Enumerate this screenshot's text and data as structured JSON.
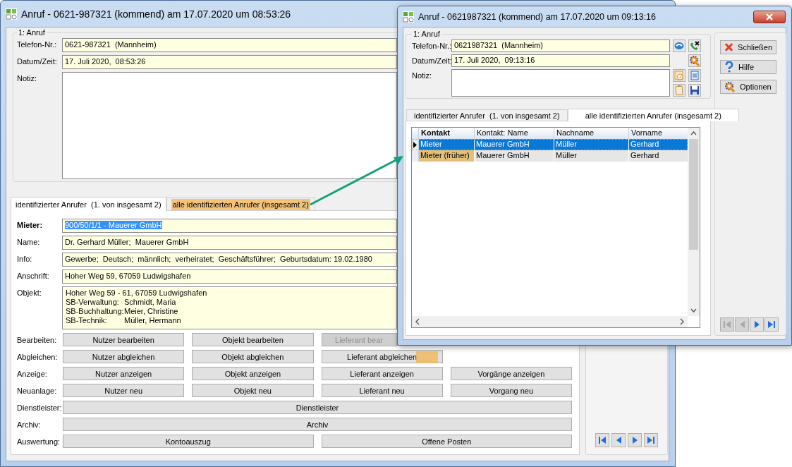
{
  "main_window": {
    "title": "Anruf - 0621-987321 (kommend) am 17.07.2020 um 08:53:26",
    "call_group": {
      "title": "1: Anruf",
      "fields": [
        {
          "label": "Telefon-Nr.:",
          "value": "0621-987321  (Mannheim)",
          "kind": "line"
        },
        {
          "label": "Datum/Zeit:",
          "value": "17. Juli 2020,  08:53:26",
          "kind": "line"
        },
        {
          "label": "Notiz:",
          "kind": "memo"
        }
      ]
    },
    "tabs": [
      {
        "label": "identifizierter Anrufer  (1. von insgesamt 2)",
        "selected": true,
        "highlighted": false
      },
      {
        "label": "alle identifizierten Anrufer (insgesamt 2)",
        "selected": false,
        "highlighted": true
      }
    ],
    "caller_fields": [
      {
        "label": "Mieter:",
        "value": "900/50/1/1 - Mauerer GmbH",
        "emphasized": true,
        "value_selected": true
      },
      {
        "label": "Name:",
        "value": "Dr. Gerhard Müller;  Mauerer GmbH",
        "emphasized": false,
        "value_selected": false
      },
      {
        "label": "Info:",
        "value": "Gewerbe;  Deutsch;  männlich;  verheiratet;  Geschäftsführer;  Geburtsdatum: 19.02.1980",
        "emphasized": false,
        "value_selected": false
      },
      {
        "label": "Anschrift:",
        "value": "Hoher Weg 59, 67059 Ludwigshafen",
        "emphasized": false,
        "value_selected": false
      }
    ],
    "object_field": {
      "label": "Objekt:",
      "address": "Hoher Weg 59 - 61, 67059 Ludwigshafen",
      "contacts": [
        {
          "role": "SB-Verwaltung:",
          "name": "Schmidt, Maria"
        },
        {
          "role": "SB-Buchhaltung:",
          "name": "Meier, Christine"
        },
        {
          "role": "SB-Technik:",
          "name": "Müller, Hermann"
        }
      ]
    },
    "action_rows": [
      {
        "label": "Bearbeiten:",
        "kind": "quarters",
        "buttons": [
          {
            "label": "Nutzer bearbeiten",
            "disabled": false,
            "highlighted": false
          },
          {
            "label": "Objekt bearbeiten",
            "disabled": false,
            "highlighted": false
          },
          {
            "label": "Lieferant bear",
            "disabled": true,
            "highlighted": false,
            "clipped": true
          }
        ]
      },
      {
        "label": "Abgleichen:",
        "kind": "quarters",
        "buttons": [
          {
            "label": "Nutzer abgleichen",
            "disabled": false,
            "highlighted": false
          },
          {
            "label": "Objekt abgleichen",
            "disabled": false,
            "highlighted": false
          },
          {
            "label": "Lieferant abgleichen",
            "disabled": false,
            "highlighted": true
          }
        ]
      },
      {
        "label": "Anzeige:",
        "kind": "quarters",
        "buttons": [
          {
            "label": "Nutzer anzeigen",
            "disabled": false,
            "highlighted": false
          },
          {
            "label": "Objekt anzeigen",
            "disabled": false,
            "highlighted": false
          },
          {
            "label": "Lieferant anzeigen",
            "disabled": false,
            "highlighted": false
          },
          {
            "label": "Vorgänge anzeigen",
            "disabled": false,
            "highlighted": false
          }
        ]
      },
      {
        "label": "Neuanlage:",
        "kind": "quarters",
        "buttons": [
          {
            "label": "Nutzer neu",
            "disabled": false,
            "highlighted": false
          },
          {
            "label": "Objekt neu",
            "disabled": false,
            "highlighted": false
          },
          {
            "label": "Lieferant neu",
            "disabled": false,
            "highlighted": false
          },
          {
            "label": "Vorgang neu",
            "disabled": false,
            "highlighted": false
          }
        ]
      },
      {
        "label": "Dienstleister:",
        "kind": "full",
        "buttons": [
          {
            "label": "Dienstleister",
            "disabled": false,
            "highlighted": false
          }
        ]
      },
      {
        "label": "Archiv:",
        "kind": "full",
        "buttons": [
          {
            "label": "Archiv",
            "disabled": false,
            "highlighted": false
          }
        ]
      },
      {
        "label": "Auswertung:",
        "kind": "halves",
        "buttons": [
          {
            "label": "Kontoauszug",
            "disabled": false,
            "highlighted": false
          },
          {
            "label": "Offene Posten",
            "disabled": false,
            "highlighted": false
          }
        ]
      }
    ],
    "nav_buttons": [
      {
        "kind": "first",
        "disabled": false
      },
      {
        "kind": "prev",
        "disabled": false
      },
      {
        "kind": "next",
        "disabled": false
      },
      {
        "kind": "last",
        "disabled": false
      }
    ]
  },
  "popup_window": {
    "title": "Anruf - 0621987321 (kommend) am 17.07.2020 um 09:13:16",
    "call_group": {
      "title": "1: Anruf",
      "fields": [
        {
          "label": "Telefon-Nr.:",
          "value": "0621987321  (Mannheim)",
          "kind": "line"
        },
        {
          "label": "Datum/Zeit:",
          "value": "17. Juli 2020,  09:13:16",
          "kind": "line"
        },
        {
          "label": "Notiz:",
          "kind": "memo"
        }
      ]
    },
    "side_buttons": [
      {
        "label": "Schließen",
        "kind": "close"
      },
      {
        "label": "Hilfe",
        "kind": "help"
      },
      {
        "label": "Optionen",
        "kind": "options"
      }
    ],
    "tabs": [
      {
        "label": "identifizierter Anrufer  (1. von insgesamt 2)",
        "selected": false
      },
      {
        "label": "alle identifizierten Anrufer (insgesamt 2)",
        "selected": true
      }
    ],
    "grid": {
      "columns": [
        {
          "label": "Kontakt",
          "bold": true
        },
        {
          "label": "Kontakt: Name",
          "bold": false
        },
        {
          "label": "Nachname",
          "bold": false
        },
        {
          "label": "Vorname",
          "bold": false
        }
      ],
      "rows": [
        {
          "current": true,
          "selected": true,
          "cells": [
            {
              "text": "Mieter",
              "highlighted": false
            },
            {
              "text": "Mauerer GmbH",
              "highlighted": false
            },
            {
              "text": "Müller",
              "highlighted": false
            },
            {
              "text": "Gerhard",
              "highlighted": false
            }
          ]
        },
        {
          "current": false,
          "selected": false,
          "cells": [
            {
              "text": "Mieter (früher)",
              "highlighted": true
            },
            {
              "text": "Mauerer GmbH",
              "highlighted": false
            },
            {
              "text": "Müller",
              "highlighted": false
            },
            {
              "text": "Gerhard",
              "highlighted": false
            }
          ]
        }
      ]
    },
    "nav_buttons": [
      {
        "kind": "first",
        "disabled": true
      },
      {
        "kind": "prev",
        "disabled": true
      },
      {
        "kind": "next",
        "disabled": false
      },
      {
        "kind": "last",
        "disabled": false
      }
    ]
  }
}
